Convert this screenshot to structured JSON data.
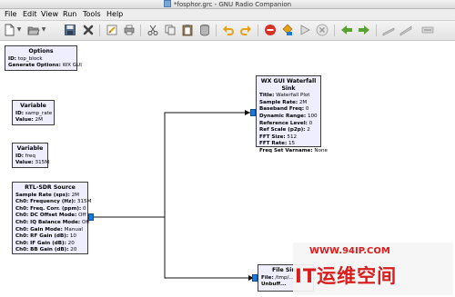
{
  "window": {
    "title": "*fosphor.grc - GNU Radio Companion"
  },
  "menu": [
    "File",
    "Edit",
    "View",
    "Run",
    "Tools",
    "Help"
  ],
  "toolbar": {
    "buttons": [
      {
        "name": "new-icon",
        "dropdown": true
      },
      {
        "name": "open-icon",
        "dropdown": true
      },
      {
        "name": "save-icon"
      },
      {
        "name": "close-icon"
      },
      {
        "name": "properties-icon"
      },
      {
        "name": "print-icon"
      },
      {
        "name": "cut-icon"
      },
      {
        "name": "copy-icon"
      },
      {
        "name": "paste-icon"
      },
      {
        "name": "delete-icon"
      },
      {
        "name": "undo-icon"
      },
      {
        "name": "redo-icon"
      },
      {
        "name": "error-icon"
      },
      {
        "name": "generate-icon"
      },
      {
        "name": "execute-icon"
      },
      {
        "name": "kill-icon"
      },
      {
        "name": "back-icon"
      },
      {
        "name": "forward-icon"
      },
      {
        "name": "disable-icon"
      },
      {
        "name": "enable-icon"
      },
      {
        "name": "bypass-icon"
      }
    ],
    "colors": {
      "accent": "#1a7adc",
      "stop": "#d93025",
      "arrow": "#5aa133",
      "undo": "#e6a117"
    }
  },
  "blocks": {
    "options": {
      "title": "Options",
      "params": [
        {
          "k": "ID:",
          "v": "top_block"
        },
        {
          "k": "Generate Options:",
          "v": "WX GUI"
        }
      ]
    },
    "variable_samp_rate": {
      "title": "Variable",
      "params": [
        {
          "k": "ID:",
          "v": "samp_rate"
        },
        {
          "k": "Value:",
          "v": "2M"
        }
      ]
    },
    "variable_freq": {
      "title": "Variable",
      "params": [
        {
          "k": "ID:",
          "v": "freq"
        },
        {
          "k": "Value:",
          "v": "315M"
        }
      ]
    },
    "rtl_sdr_source": {
      "title": "RTL-SDR Source",
      "params": [
        {
          "k": "Sample Rate (sps):",
          "v": "2M"
        },
        {
          "k": "Ch0: Frequency (Hz):",
          "v": "315M"
        },
        {
          "k": "Ch0: Freq. Corr. (ppm):",
          "v": "0"
        },
        {
          "k": "Ch0: DC Offset Mode:",
          "v": "Off"
        },
        {
          "k": "Ch0: IQ Balance Mode:",
          "v": "Off"
        },
        {
          "k": "Ch0: Gain Mode:",
          "v": "Manual"
        },
        {
          "k": "Ch0: RF Gain (dB):",
          "v": "10"
        },
        {
          "k": "Ch0: IF Gain (dB):",
          "v": "20"
        },
        {
          "k": "Ch0: BB Gain (dB):",
          "v": "20"
        }
      ]
    },
    "waterfall_sink": {
      "title": "WX GUI Waterfall Sink",
      "params": [
        {
          "k": "Title:",
          "v": "Waterfall Plot"
        },
        {
          "k": "Sample Rate:",
          "v": "2M"
        },
        {
          "k": "Baseband Freq:",
          "v": "0"
        },
        {
          "k": "Dynamic Range:",
          "v": "100"
        },
        {
          "k": "Reference Level:",
          "v": "0"
        },
        {
          "k": "Ref Scale (p2p):",
          "v": "2"
        },
        {
          "k": "FFT Size:",
          "v": "512"
        },
        {
          "k": "FFT Rate:",
          "v": "15"
        },
        {
          "k": "Freq Set Varname:",
          "v": "None"
        }
      ]
    },
    "file_sink": {
      "title": "File Sink",
      "params": [
        {
          "k": "File:",
          "v": "/tmp/..."
        },
        {
          "k": "Unbuff...",
          "v": ""
        }
      ]
    }
  },
  "watermark": {
    "url": "WWW.94IP.COM",
    "logo": "IT运维空间"
  }
}
